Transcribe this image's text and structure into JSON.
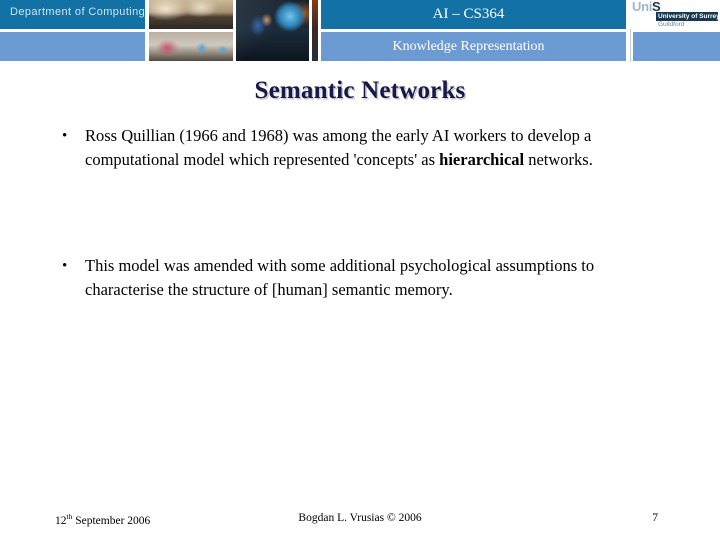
{
  "header": {
    "department_label": "Department of Computing",
    "course_code": "AI – CS364",
    "subject": "Knowledge Representation",
    "logo": {
      "mark_prefix": "Uni",
      "mark_suffix": "S",
      "university": "University of Surrey",
      "town": "Guildford"
    },
    "photos": [
      {
        "name": "lecture-hall-photo"
      },
      {
        "name": "computer-lab-photo"
      },
      {
        "name": "students-at-laptop-photo"
      }
    ],
    "colors": {
      "band_dark": "#1272a5",
      "band_light": "#6b9bd2",
      "logo_dark": "#17384f"
    }
  },
  "title": "Semantic Networks",
  "bullets": [
    {
      "marker": "•",
      "segments": [
        {
          "text": "Ross Quillian (1966 and 1968) was among the early AI workers to develop a computational model which represented 'concepts' as ",
          "bold": false
        },
        {
          "text": "hierarchical",
          "bold": true
        },
        {
          "text": " networks.",
          "bold": false
        }
      ]
    },
    {
      "marker": "•",
      "segments": [
        {
          "text": "This model was amended with some additional psychological assumptions to characterise the structure of [human] semantic memory.",
          "bold": false
        }
      ]
    }
  ],
  "footer": {
    "date_number": "12",
    "date_ordinal": "th",
    "date_rest": " September 2006",
    "author": "Bogdan L. Vrusias © 2006",
    "page_number": "7"
  },
  "theme": {
    "title_color": "#17194a",
    "body_color": "#000000",
    "background": "#ffffff"
  }
}
